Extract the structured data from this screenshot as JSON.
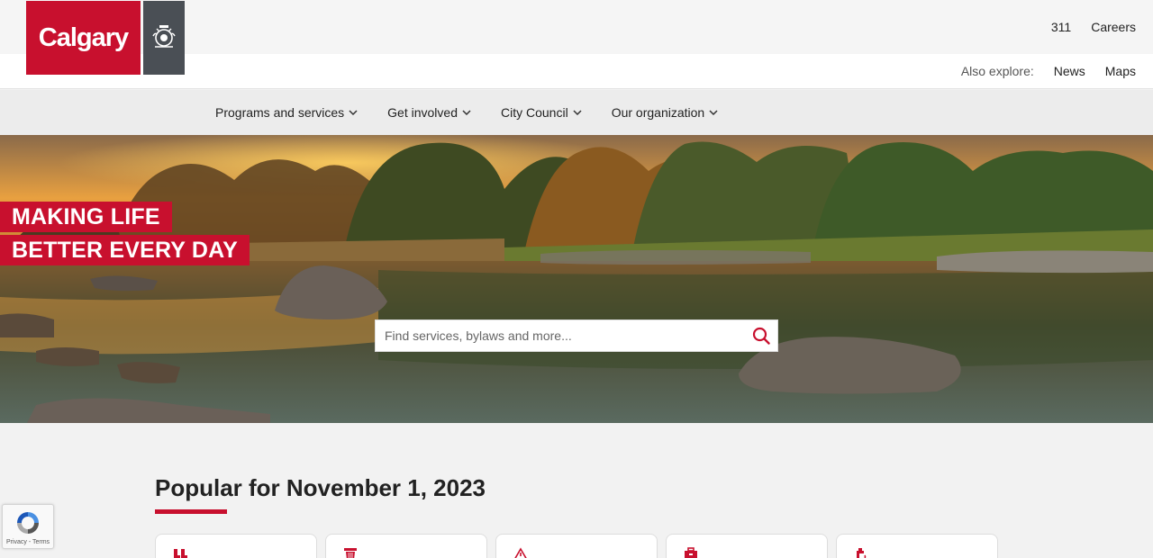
{
  "header": {
    "logo_text": "Calgary",
    "utility_links": [
      "311",
      "Careers"
    ],
    "explore_label": "Also explore:",
    "explore_links": [
      "News",
      "Maps"
    ]
  },
  "nav": {
    "items": [
      "Programs and services",
      "Get involved",
      "City Council",
      "Our organization"
    ]
  },
  "hero": {
    "tagline_line1": "MAKING LIFE",
    "tagline_line2": "BETTER EVERY DAY",
    "search_placeholder": "Find services, bylaws and more..."
  },
  "popular": {
    "title": "Popular for November 1, 2023",
    "cards": [
      {
        "icon": "boots-icon"
      },
      {
        "icon": "trash-bin-icon"
      },
      {
        "icon": "warning-sign-icon"
      },
      {
        "icon": "toolbox-icon"
      },
      {
        "icon": "faucet-icon"
      }
    ]
  },
  "recaptcha": {
    "label": "Privacy - Terms"
  },
  "colors": {
    "brand_red": "#c8102e",
    "logo_grey": "#4a4f55"
  }
}
